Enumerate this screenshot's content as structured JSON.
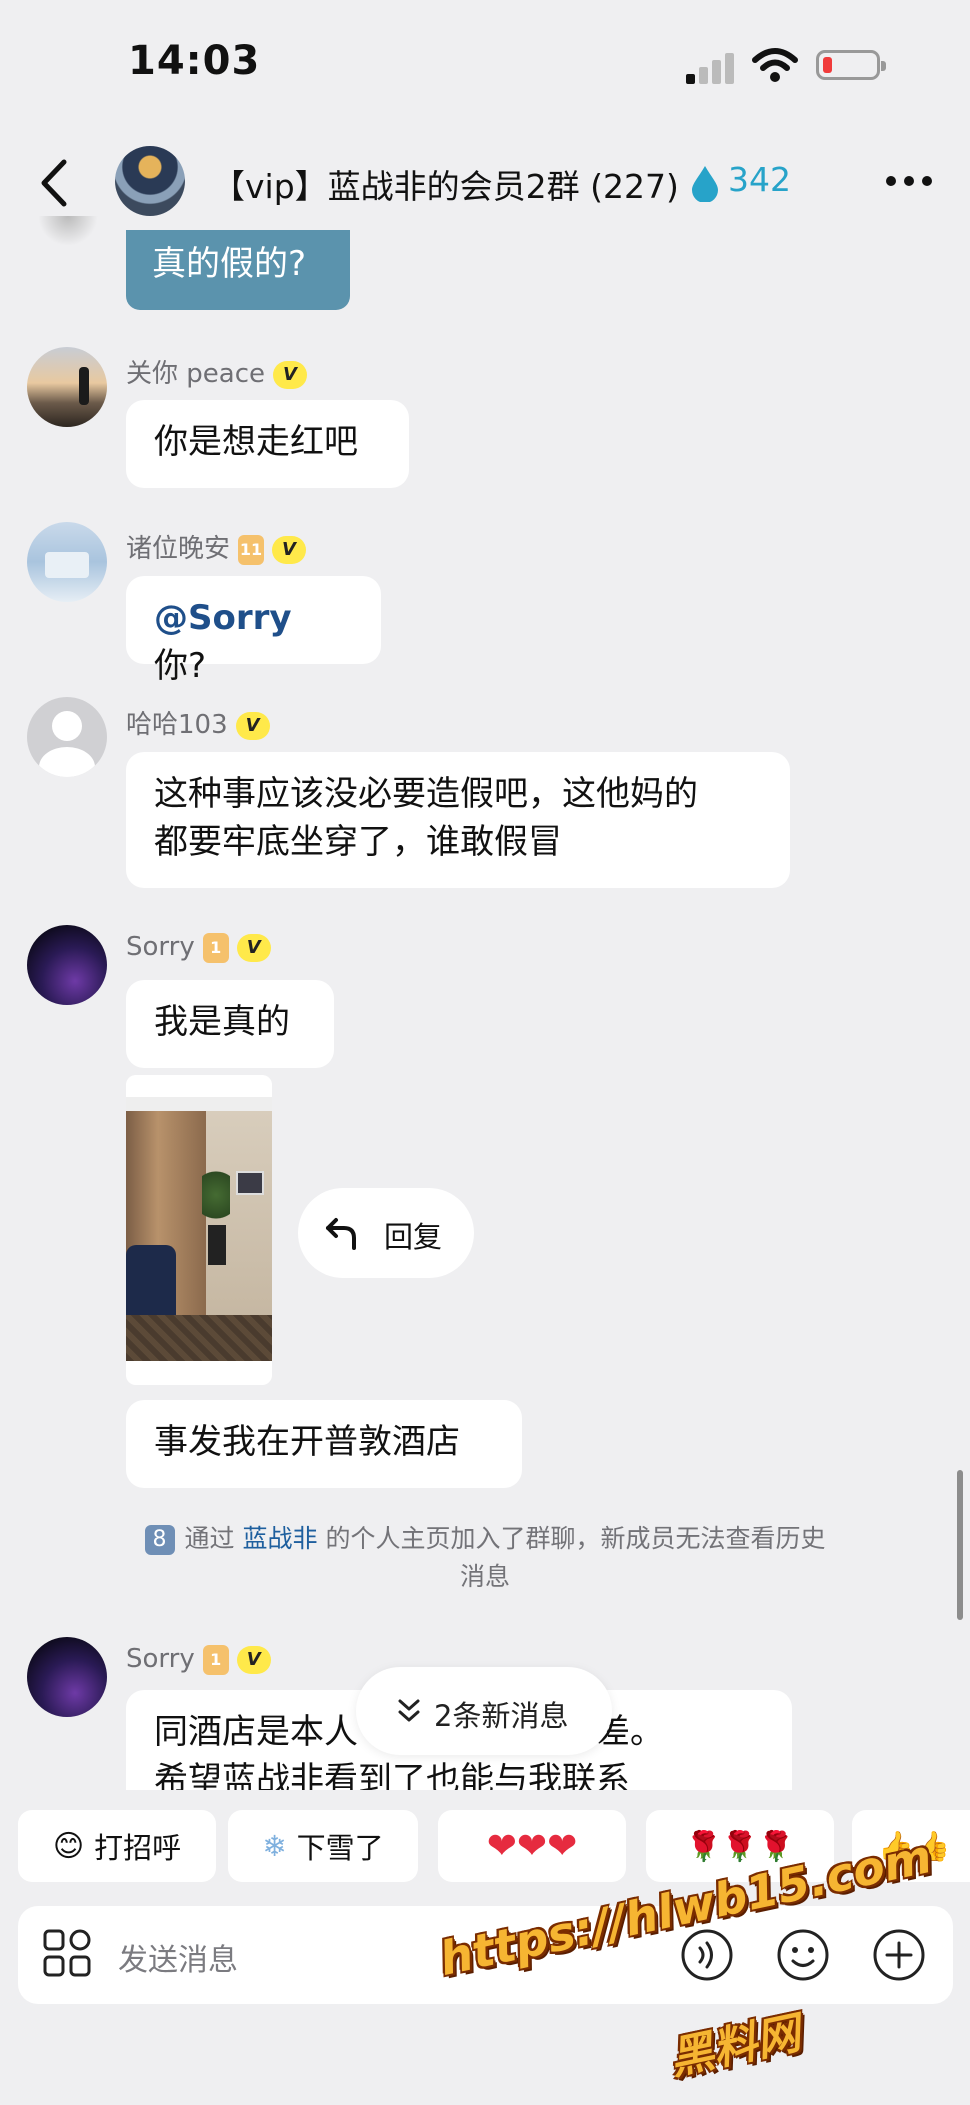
{
  "status_bar": {
    "time": "14:03"
  },
  "header": {
    "title": "【vip】蓝战非的会员2群 (227)",
    "count": "342",
    "accent": "#27a3c9"
  },
  "messages": [
    {
      "text": "真的假的?"
    },
    {
      "name": "关你 peace",
      "badge": "V",
      "text": "你是想走红吧"
    },
    {
      "name": "诸位晚安",
      "level": "11",
      "badge": "V",
      "mention": "@Sorry",
      "text": "你?"
    },
    {
      "name": "哈哈103",
      "badge": "V",
      "line1": "这种事应该没必要造假吧，这他妈的",
      "line2": "都要牢底坐穿了，谁敢假冒"
    },
    {
      "name": "Sorry",
      "level": "1",
      "badge": "V",
      "text": "我是真的",
      "text2": "事发我在开普敦酒店"
    },
    {
      "name": "Sorry",
      "level": "1",
      "badge": "V",
      "line1": "同酒店是本人",
      "line1b": "程有差。",
      "line2": "希望蓝战非看到了也能与我联系"
    }
  ],
  "reply_label": "回复",
  "system": {
    "icon": "8",
    "prefix": "通过",
    "link": "蓝战非",
    "suffix": "的个人主页加入了群聊，新成员无法查看历史",
    "line2": "消息"
  },
  "new_messages": "2条新消息",
  "quick_replies": [
    "打招呼",
    "下雪了",
    "❤❤❤",
    "🌹🌹🌹",
    "👍👍"
  ],
  "input": {
    "placeholder": "发送消息"
  },
  "watermark": {
    "url": "https://hlwb15.com",
    "name": "黑料网"
  }
}
